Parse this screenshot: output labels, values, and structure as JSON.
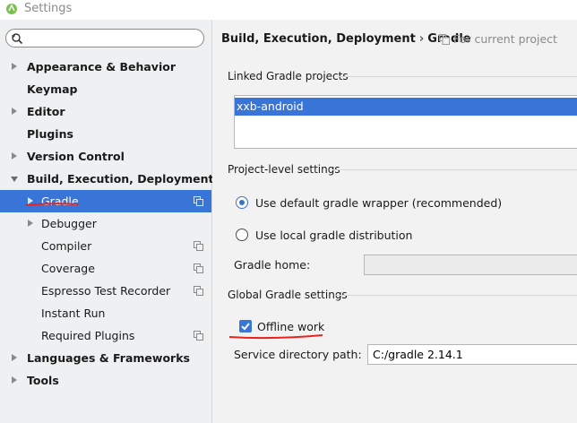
{
  "window": {
    "title": "Settings"
  },
  "sidebar": {
    "search": {
      "value": "",
      "placeholder": ""
    },
    "items": [
      {
        "label": "Appearance & Behavior"
      },
      {
        "label": "Keymap"
      },
      {
        "label": "Editor"
      },
      {
        "label": "Plugins"
      },
      {
        "label": "Version Control"
      },
      {
        "label": "Build, Execution, Deployment"
      },
      {
        "label": "Gradle"
      },
      {
        "label": "Debugger"
      },
      {
        "label": "Compiler"
      },
      {
        "label": "Coverage"
      },
      {
        "label": "Espresso Test Recorder"
      },
      {
        "label": "Instant Run"
      },
      {
        "label": "Required Plugins"
      },
      {
        "label": "Languages & Frameworks"
      },
      {
        "label": "Tools"
      }
    ],
    "selected": "Gradle"
  },
  "main": {
    "breadcrumb": {
      "parent": "Build, Execution, Deployment",
      "separator": "›",
      "current": "Gradle"
    },
    "scope_label": "For current project",
    "linked_projects": {
      "title": "Linked Gradle projects",
      "items": [
        "xxb-android"
      ]
    },
    "project_level": {
      "title": "Project-level settings",
      "options": [
        {
          "label": "Use default gradle wrapper (recommended)",
          "selected": true
        },
        {
          "label": "Use local gradle distribution",
          "selected": false
        }
      ],
      "gradle_home_label": "Gradle home:",
      "gradle_home_value": ""
    },
    "global": {
      "title": "Global Gradle settings",
      "offline_label": "Offline work",
      "offline_checked": true,
      "service_dir_label": "Service directory path:",
      "service_dir_value": "C:/gradle 2.14.1"
    }
  },
  "colors": {
    "selection": "#3875d7",
    "annotation": "#e8241f",
    "sidebar_bg": "#eef0f2",
    "panel_bg": "#f2f2f2"
  }
}
